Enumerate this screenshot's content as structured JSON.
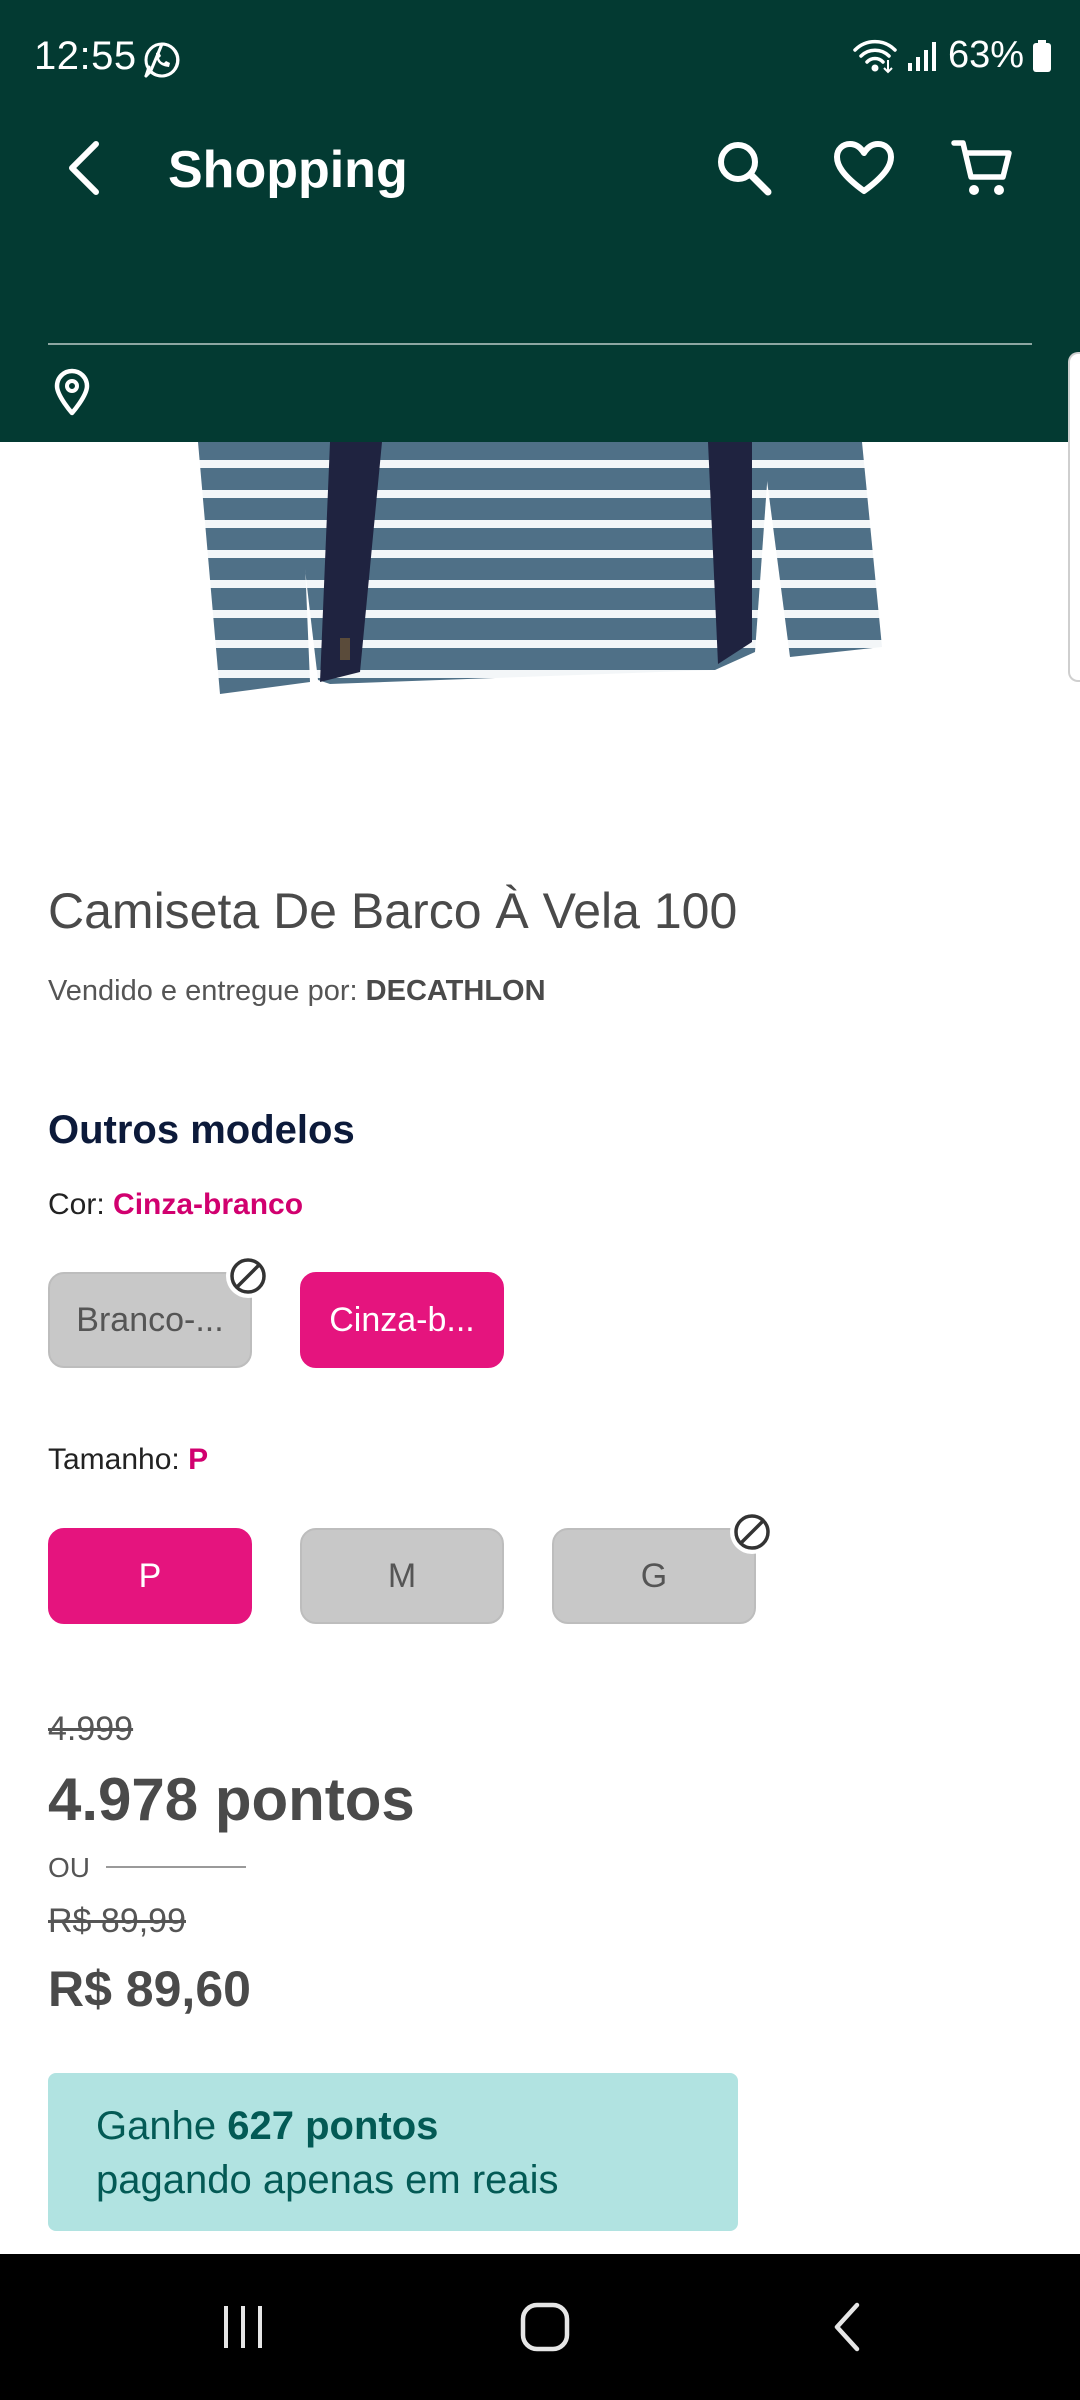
{
  "status_bar": {
    "time": "12:55",
    "battery": "63%"
  },
  "header": {
    "title": "Shopping"
  },
  "product": {
    "name": "Camiseta De Barco À Vela 100",
    "seller_prefix": "Vendido e entregue por:",
    "seller_name": "DECATHLON"
  },
  "models": {
    "heading": "Outros modelos",
    "color_label": "Cor:",
    "color_value": "Cinza-branco",
    "colors": [
      {
        "label": "Branco-...",
        "selected": false,
        "available": false
      },
      {
        "label": "Cinza-b...",
        "selected": true,
        "available": true
      }
    ],
    "size_label": "Tamanho:",
    "size_value": "P",
    "sizes": [
      {
        "label": "P",
        "selected": true,
        "available": true
      },
      {
        "label": "M",
        "selected": false,
        "available": true
      },
      {
        "label": "G",
        "selected": false,
        "available": false
      }
    ]
  },
  "pricing": {
    "old_points": "4.999",
    "points": "4.978 pontos",
    "or_label": "OU",
    "old_price": "R$ 89,99",
    "price": "R$ 89,60"
  },
  "promo": {
    "prefix": "Ganhe",
    "highlight": "627 pontos",
    "suffix": "pagando apenas em reais"
  },
  "colors": {
    "header_bg": "#033a32",
    "accent": "#e5147e",
    "promo_bg": "#b1e3e1",
    "promo_text": "#035a55"
  },
  "icons": {
    "status": [
      "whatsapp-icon",
      "wifi-icon",
      "signal-icon",
      "battery-icon"
    ],
    "header": [
      "back-arrow-icon",
      "search-icon",
      "heart-icon",
      "cart-icon",
      "location-pin-icon"
    ],
    "nav": [
      "recent-apps-icon",
      "home-icon",
      "back-nav-icon"
    ]
  }
}
